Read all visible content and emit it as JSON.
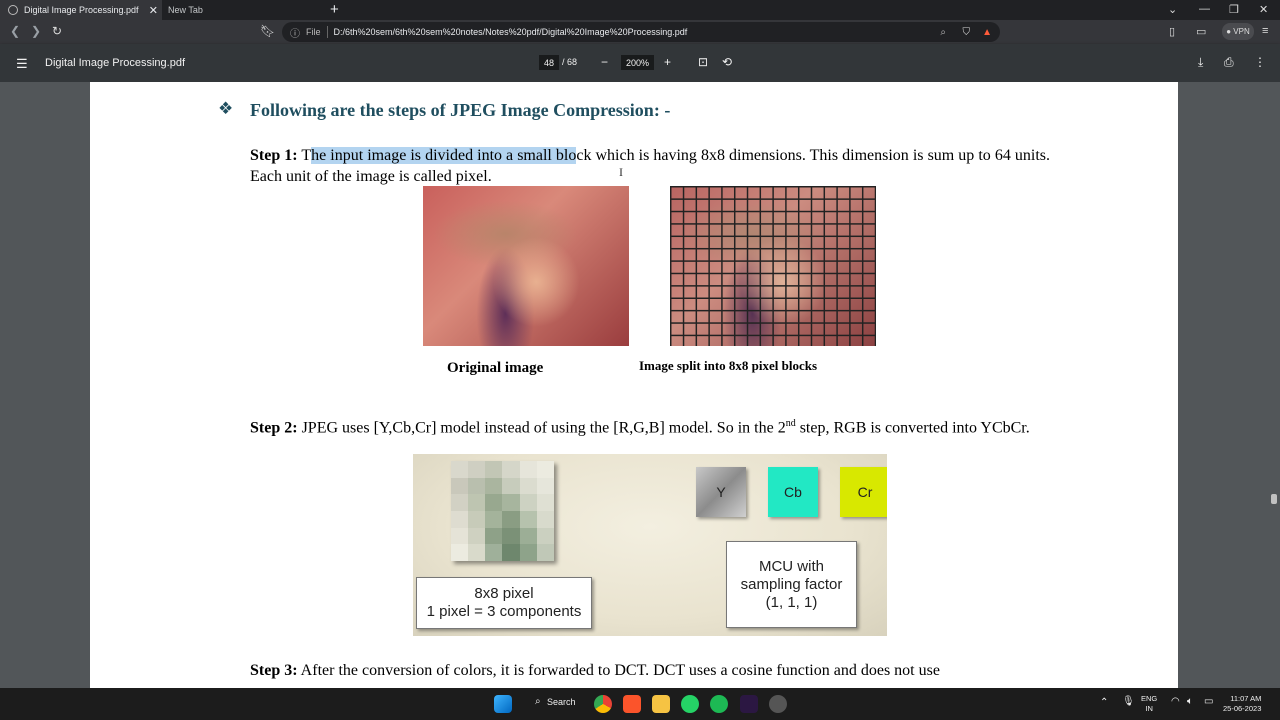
{
  "browser": {
    "tabs": [
      {
        "label": "Digital Image Processing.pdf",
        "active": true
      },
      {
        "label": "New Tab",
        "active": false
      }
    ],
    "address": {
      "scheme_label": "File",
      "url": "D:/6th%20sem/6th%20sem%20notes/Notes%20pdf/Digital%20Image%20Processing.pdf"
    },
    "vpn_label": "● VPN"
  },
  "pdf_toolbar": {
    "title": "Digital Image Processing.pdf",
    "page_current": "48",
    "page_total": "/ 68",
    "zoom": "200%"
  },
  "document": {
    "heading": "Following are the steps of JPEG Image Compression: -",
    "step1": {
      "label": "Step 1:",
      "pre_highlight": " T",
      "highlight": "he input image is divided into a small blo",
      "post_highlight": "ck which is having 8x8 dimensions. This dimension is sum up to 64 units. Each unit of the image is called pixel."
    },
    "caption_original": "Original image",
    "caption_split": "Image split into 8x8 pixel blocks",
    "step2": {
      "label": "Step 2:",
      "text_a": " JPEG uses [Y,Cb,Cr] model instead of using the [R,G,B] model. So in the 2",
      "sup": "nd",
      "text_b": " step, RGB is converted into YCbCr."
    },
    "diagram": {
      "comp_y": "Y",
      "comp_cb": "Cb",
      "comp_cr": "Cr",
      "pixel_box_line1": "8x8 pixel",
      "pixel_box_line2": "1 pixel = 3 components",
      "mcu_line1": "MCU with",
      "mcu_line2": "sampling factor",
      "mcu_line3": "(1, 1, 1)",
      "colors": {
        "cb": "#22e8c4",
        "cr": "#d8e800",
        "y": "#9a9a9a"
      }
    },
    "step3": {
      "label": "Step 3:",
      "text": " After the conversion of colors, it is forwarded to DCT. DCT uses a cosine function and does not use"
    }
  },
  "taskbar": {
    "search_label": "Search",
    "lang_line1": "ENG",
    "lang_line2": "IN",
    "time": "11:07 AM",
    "date": "25-06-2023"
  }
}
